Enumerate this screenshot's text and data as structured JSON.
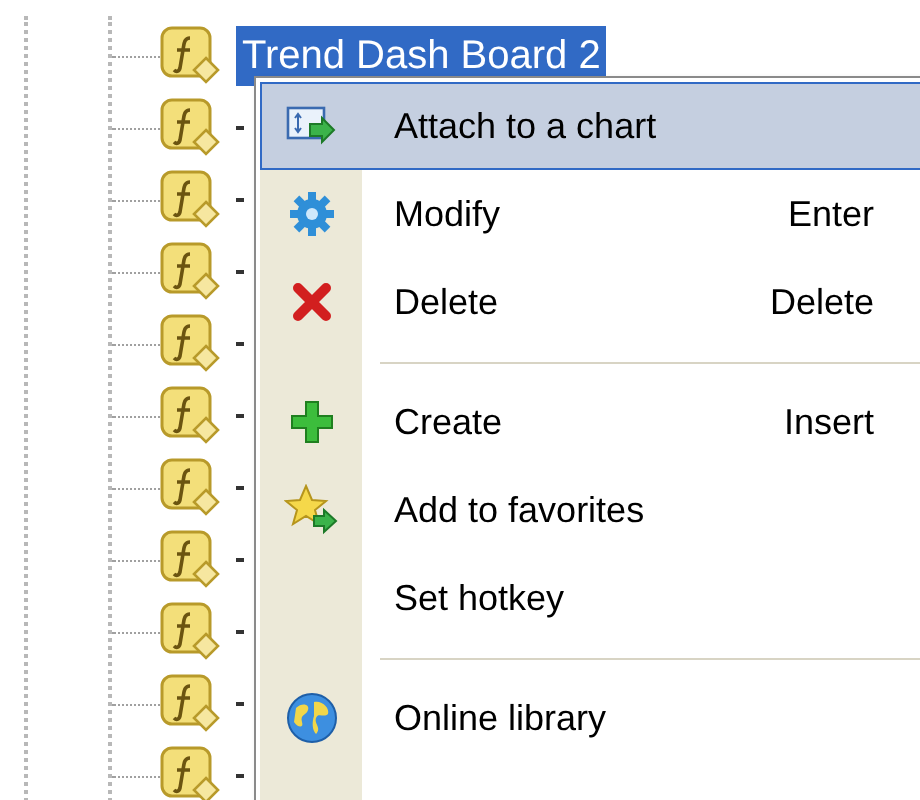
{
  "tree": {
    "items": [
      {
        "label": "Trend Dash Board 2",
        "selected": true
      },
      {
        "selected": false
      },
      {
        "selected": false
      },
      {
        "selected": false
      },
      {
        "selected": false
      },
      {
        "selected": false
      },
      {
        "selected": false
      },
      {
        "selected": false
      },
      {
        "selected": false
      },
      {
        "selected": false
      },
      {
        "selected": false
      }
    ]
  },
  "context_menu": {
    "items": [
      {
        "kind": "item",
        "label": "Attach to a chart",
        "selected": true
      },
      {
        "kind": "item",
        "label": "Modify",
        "shortcut": "Enter",
        "selected": false
      },
      {
        "kind": "item",
        "label": "Delete",
        "shortcut": "Delete",
        "selected": false
      },
      {
        "kind": "separator"
      },
      {
        "kind": "item",
        "label": "Create",
        "shortcut": "Insert",
        "selected": false
      },
      {
        "kind": "item",
        "label": "Add to favorites",
        "selected": false
      },
      {
        "kind": "item",
        "label": "Set hotkey",
        "selected": false
      },
      {
        "kind": "separator"
      },
      {
        "kind": "item",
        "label": "Online library",
        "selected": false
      }
    ]
  }
}
